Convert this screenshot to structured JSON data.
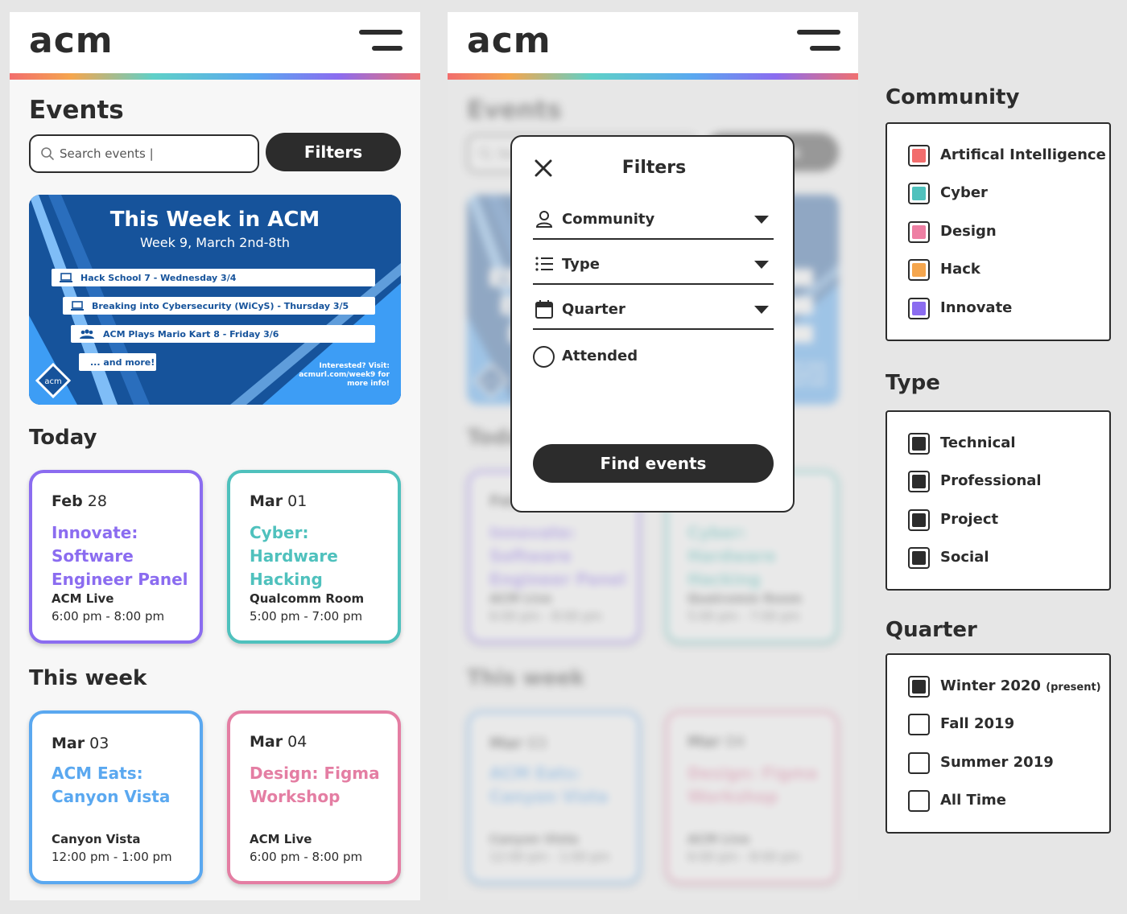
{
  "header": {
    "logo": "acm"
  },
  "events_page": {
    "heading": "Events",
    "search_placeholder": "Search events |",
    "filters_label": "Filters",
    "banner": {
      "title": "This Week in ACM",
      "subtitle": "Week 9, March 2nd-8th",
      "items": [
        {
          "label": "Hack School 7 - Wednesday 3/4",
          "icon": "laptop-icon"
        },
        {
          "label": "Breaking into Cybersecurity (WiCyS) - Thursday 3/5",
          "icon": "laptop-icon"
        },
        {
          "label": "ACM Plays Mario Kart 8 - Friday 3/6",
          "icon": "people-icon"
        },
        {
          "label": "... and more!"
        }
      ],
      "note": "Interested? Visit: acmurl.com/week9 for more info!",
      "logo_text": "acm"
    },
    "today_heading": "Today",
    "this_week_heading": "This week",
    "today_cards": [
      {
        "month": "Feb",
        "day": "28",
        "title": "Innovate: Software Engineer Panel",
        "location": "ACM Live",
        "time": "6:00 pm - 8:00 pm",
        "color": "#8b6cf0"
      },
      {
        "month": "Mar",
        "day": "01",
        "title": "Cyber: Hardware Hacking",
        "location": "Qualcomm Room",
        "time": "5:00 pm - 7:00 pm",
        "color": "#4fc1bd"
      }
    ],
    "week_cards": [
      {
        "month": "Mar",
        "day": "03",
        "title": "ACM Eats: Canyon Vista",
        "location": "Canyon Vista",
        "time": "12:00 pm - 1:00 pm",
        "color": "#5aa8f0"
      },
      {
        "month": "Mar",
        "day": "04",
        "title": "Design: Figma Workshop",
        "location": "ACM Live",
        "time": "6:00 pm - 8:00 pm",
        "color": "#e47ea3"
      }
    ]
  },
  "filter_modal": {
    "title": "Filters",
    "rows": [
      {
        "label": "Community",
        "icon": "person-icon"
      },
      {
        "label": "Type",
        "icon": "list-icon"
      },
      {
        "label": "Quarter",
        "icon": "calendar-icon"
      }
    ],
    "attended_label": "Attended",
    "find_label": "Find events"
  },
  "legend": {
    "community": {
      "heading": "Community",
      "options": [
        {
          "label": "Artifical Intelligence",
          "color": "#f26d6d"
        },
        {
          "label": "Cyber",
          "color": "#4fc1bd"
        },
        {
          "label": "Design",
          "color": "#ee7fa3"
        },
        {
          "label": "Hack",
          "color": "#f5a64e"
        },
        {
          "label": "Innovate",
          "color": "#8b6cf0"
        }
      ]
    },
    "type": {
      "heading": "Type",
      "options": [
        {
          "label": "Technical",
          "checked": true
        },
        {
          "label": "Professional",
          "checked": true
        },
        {
          "label": "Project",
          "checked": true
        },
        {
          "label": "Social",
          "checked": true
        }
      ]
    },
    "quarter": {
      "heading": "Quarter",
      "options": [
        {
          "label": "Winter 2020",
          "suffix": "(present)",
          "checked": true
        },
        {
          "label": "Fall 2019",
          "suffix": "",
          "checked": false
        },
        {
          "label": "Summer 2019",
          "suffix": "",
          "checked": false
        },
        {
          "label": "All Time",
          "suffix": "",
          "checked": false
        }
      ]
    }
  }
}
